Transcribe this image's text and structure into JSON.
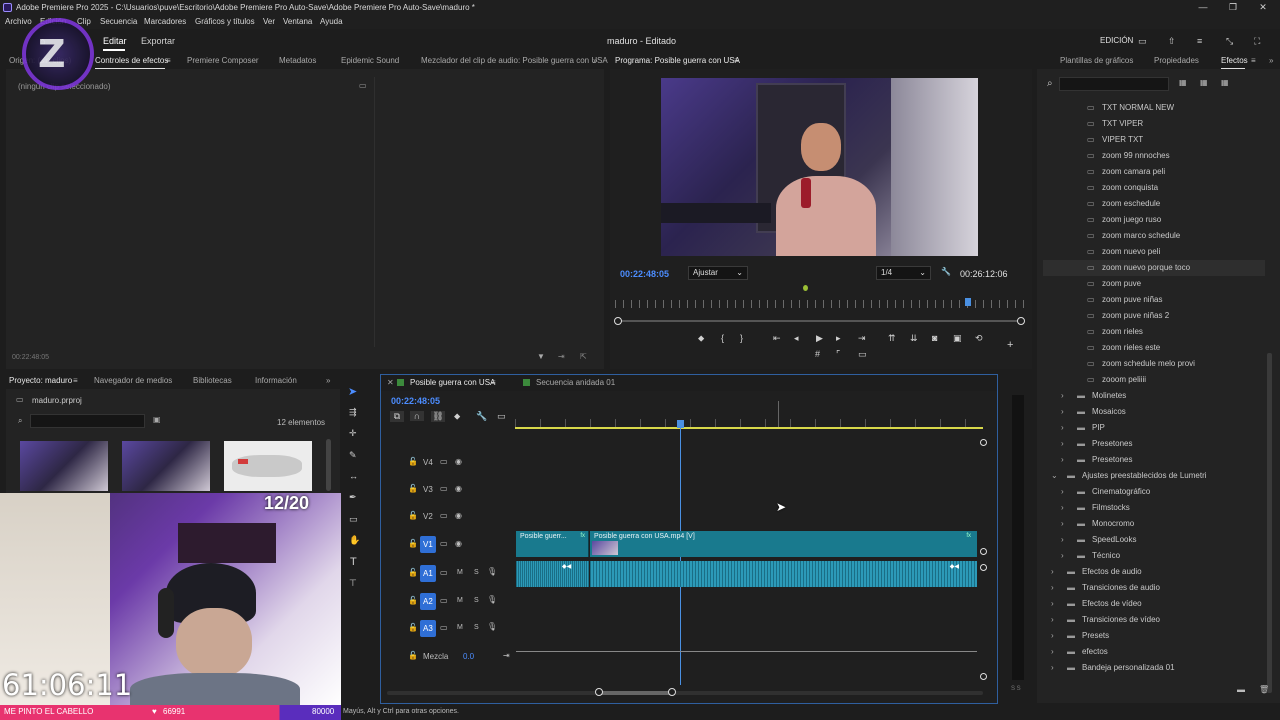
{
  "app": {
    "title": "Adobe Premiere Pro 2025 - C:\\Usuarios\\puve\\Escritorio\\Adobe Premiere Pro Auto-Save\\Adobe Premiere Pro Auto-Save\\maduro *",
    "menu": [
      "Archivo",
      "Edición",
      "Clip",
      "Secuencia",
      "Marcadores",
      "Gráficos y títulos",
      "Ver",
      "Ventana",
      "Ayuda"
    ],
    "workspace_tabs": [
      "Editar",
      "Exportar"
    ],
    "project_label": "maduro - Editado",
    "workspace_mode": "EDICIÓN"
  },
  "source_panel": {
    "tabs": [
      "Origen: (sin clips)",
      "Controles de efectos",
      "Premiere Composer",
      "Metadatos",
      "Epidemic Sound",
      "Mezclador del clip de audio: Posible guerra con USA"
    ],
    "no_clip": "(ningún clip seleccionado)",
    "timecode": "00:22:48:05"
  },
  "program": {
    "title": "Programa: Posible guerra con USA",
    "timecode": "00:22:48:05",
    "fit": "Ajustar",
    "resolution": "1/4",
    "duration": "00:26:12:06"
  },
  "project": {
    "tabs": [
      "Proyecto: maduro",
      "Navegador de medios",
      "Bibliotecas",
      "Información"
    ],
    "file": "maduro.prproj",
    "count": "12 elementos"
  },
  "timeline": {
    "tabs": [
      "Posible guerra con USA",
      "Secuencia anidada 01"
    ],
    "timecode": "00:22:48:05",
    "video_tracks": [
      "V4",
      "V3",
      "V2",
      "V1"
    ],
    "audio_tracks": [
      "A1",
      "A2",
      "A3"
    ],
    "mix_label": "Mezcla",
    "mix_value": "0.0",
    "clip_short": "Posible guerr...",
    "clip_main": "Posible guerra con USA.mp4 [V]",
    "m_label": "M",
    "s_label": "S"
  },
  "effects": {
    "tabs": [
      "Plantillas de gráficos",
      "Propiedades",
      "Efectos"
    ],
    "items": [
      {
        "label": "TXT NORMAL NEW",
        "level": 2,
        "type": "preset"
      },
      {
        "label": "TXT VIPER",
        "level": 2,
        "type": "preset"
      },
      {
        "label": "VIPER TXT",
        "level": 2,
        "type": "preset"
      },
      {
        "label": "zoom 99 nnnoches",
        "level": 2,
        "type": "preset"
      },
      {
        "label": "zoom camara peli",
        "level": 2,
        "type": "preset"
      },
      {
        "label": "zoom conquista",
        "level": 2,
        "type": "preset"
      },
      {
        "label": "zoom eschedule",
        "level": 2,
        "type": "preset"
      },
      {
        "label": "zoom juego ruso",
        "level": 2,
        "type": "preset"
      },
      {
        "label": "zoom marco schedule",
        "level": 2,
        "type": "preset"
      },
      {
        "label": "zoom nuevo peli",
        "level": 2,
        "type": "preset"
      },
      {
        "label": "zoom nuevo porque toco",
        "level": 2,
        "type": "preset"
      },
      {
        "label": "zoom puve",
        "level": 2,
        "type": "preset"
      },
      {
        "label": "zoom puve niñas",
        "level": 2,
        "type": "preset"
      },
      {
        "label": "zoom puve niñas 2",
        "level": 2,
        "type": "preset"
      },
      {
        "label": "zoom rieles",
        "level": 2,
        "type": "preset"
      },
      {
        "label": "zoom rieles este",
        "level": 2,
        "type": "preset"
      },
      {
        "label": "zoom schedule melo provi",
        "level": 2,
        "type": "preset"
      },
      {
        "label": "zooom peliiii",
        "level": 2,
        "type": "preset"
      },
      {
        "label": "Molinetes",
        "level": 1,
        "type": "folder"
      },
      {
        "label": "Mosaicos",
        "level": 1,
        "type": "folder"
      },
      {
        "label": "PIP",
        "level": 1,
        "type": "folder"
      },
      {
        "label": "Presetones",
        "level": 1,
        "type": "folder"
      },
      {
        "label": "Presetones",
        "level": 1,
        "type": "folder"
      },
      {
        "label": "Ajustes preestablecidos de Lumetri",
        "level": 0,
        "type": "folder-open"
      },
      {
        "label": "Cinematográfico",
        "level": 1,
        "type": "folder"
      },
      {
        "label": "Filmstocks",
        "level": 1,
        "type": "folder"
      },
      {
        "label": "Monocromo",
        "level": 1,
        "type": "folder"
      },
      {
        "label": "SpeedLooks",
        "level": 1,
        "type": "folder"
      },
      {
        "label": "Técnico",
        "level": 1,
        "type": "folder"
      },
      {
        "label": "Efectos de audio",
        "level": 0,
        "type": "folder"
      },
      {
        "label": "Transiciones de audio",
        "level": 0,
        "type": "folder"
      },
      {
        "label": "Efectos de vídeo",
        "level": 0,
        "type": "folder"
      },
      {
        "label": "Transiciones de vídeo",
        "level": 0,
        "type": "folder"
      },
      {
        "label": "Presets",
        "level": 0,
        "type": "folder"
      },
      {
        "label": "efectos",
        "level": 0,
        "type": "folder"
      },
      {
        "label": "Bandeja personalizada 01",
        "level": 0,
        "type": "folder"
      }
    ]
  },
  "overlay": {
    "counter": "12/20",
    "clock": "61:06:11",
    "banner": "ME PINTO EL CABELLO",
    "stat1": "66991",
    "stat2": "80000"
  },
  "status": "Mayús, Alt y Ctrl para otras opciones.",
  "colors": {
    "accent": "#4c8dff",
    "clip_video": "#197a8e",
    "playhead": "#4a90e2",
    "banner": "#e8336f",
    "overlay_purple": "#5a2dbd"
  }
}
